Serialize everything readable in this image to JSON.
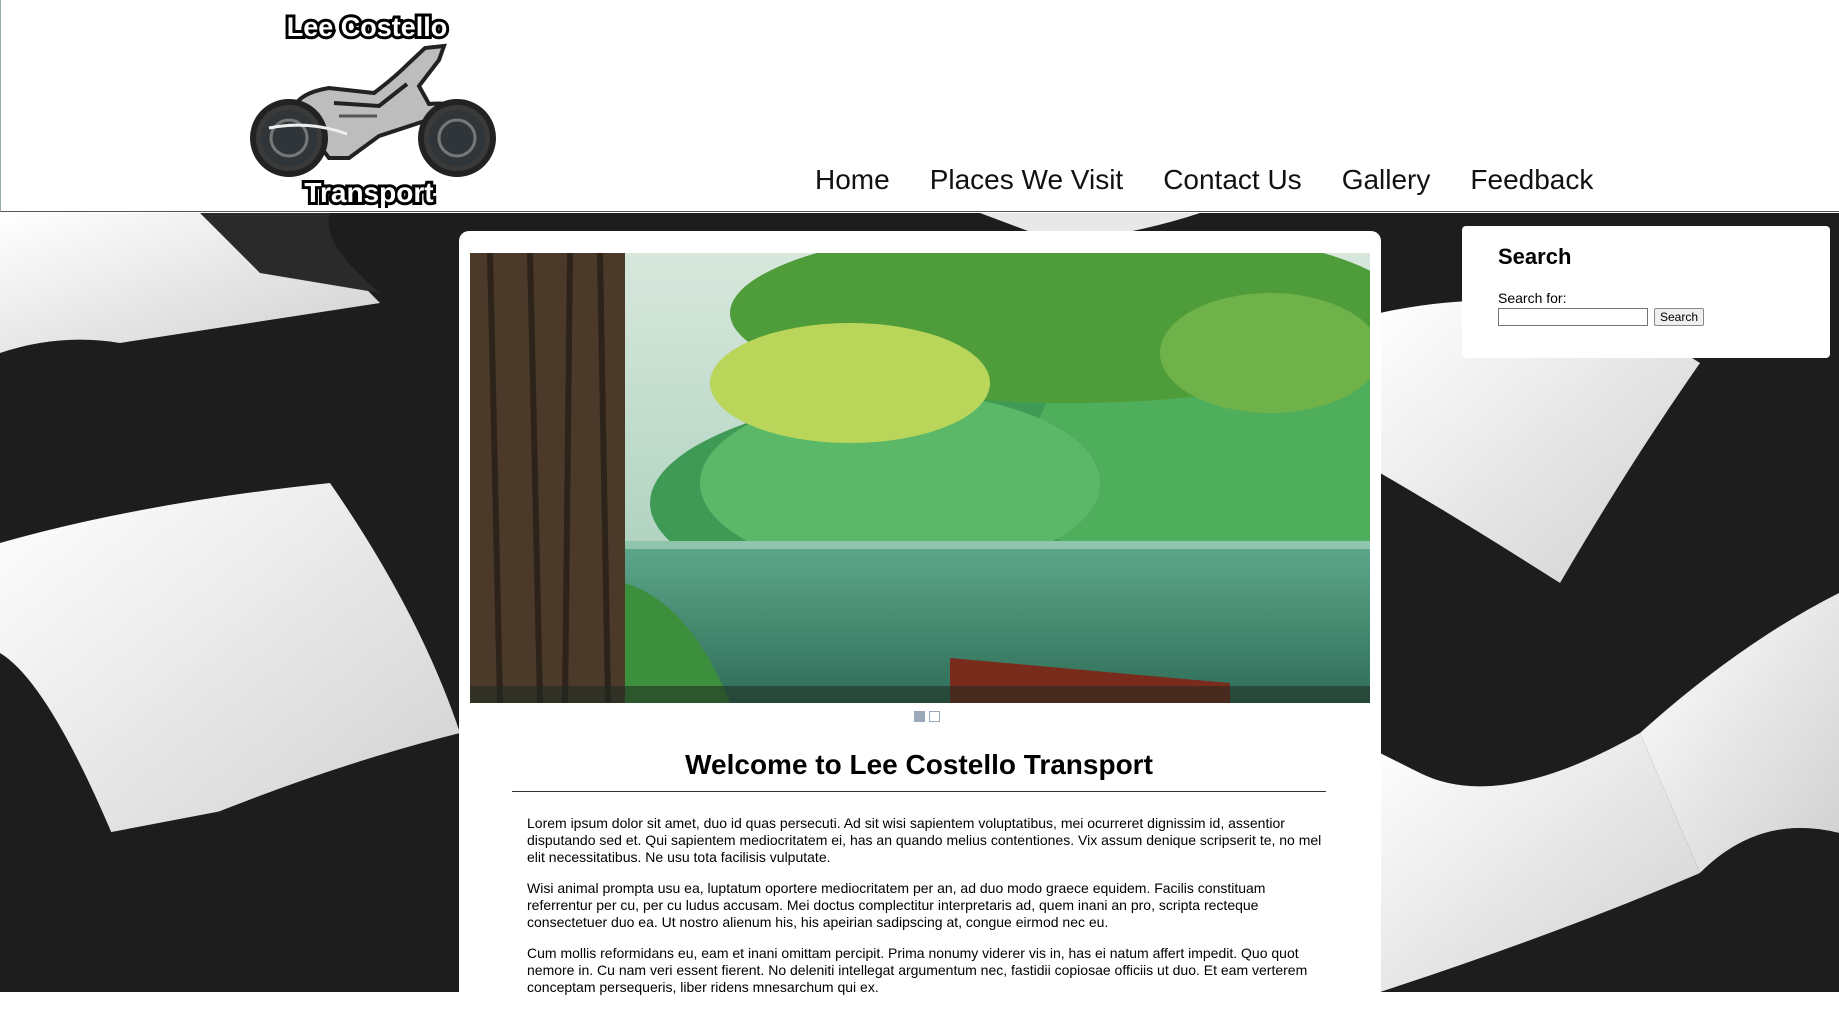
{
  "header": {
    "logo": {
      "top_text": "Lee Costello",
      "bottom_text": "Transport"
    },
    "nav": [
      "Home",
      "Places We Visit",
      "Contact Us",
      "Gallery",
      "Feedback"
    ]
  },
  "slideshow": {
    "pages": 2,
    "active_page": 1
  },
  "main": {
    "title": "Welcome to Lee Costello Transport",
    "paragraphs": [
      "Lorem ipsum dolor sit amet, duo id quas persecuti. Ad sit wisi sapientem voluptatibus, mei ocurreret dignissim id, assentior disputando sed et. Qui sapientem mediocritatem ei, has an quando melius contentiones. Vix assum denique scripserit te, no mel elit necessitatibus. Ne usu tota facilisis vulputate.",
      "Wisi animal prompta usu ea, luptatum oportere mediocritatem per an, ad duo modo graece equidem. Facilis constituam referrentur per cu, per cu ludus accusam. Mei doctus complectitur interpretaris ad, quem inani an pro, scripta recteque consectetuer duo ea. Ut nostro alienum his, his apeirian sadipscing at, congue eirmod nec eu.",
      "Cum mollis reformidans eu, eam et inani omittam percipit. Prima nonumy viderer vis in, has ei natum affert impedit. Quo quot nemore in. Cu nam veri essent fierent. No deleniti intellegat argumentum nec, fastidii copiosae officiis ut duo. Et eam verterem conceptam persequeris, liber ridens mnesarchum qui ex."
    ]
  },
  "sidebar": {
    "title": "Search",
    "label": "Search for:",
    "input_value": "",
    "button_label": "Search"
  },
  "colors": {
    "flag_dark": "#1d1d1d",
    "flag_light": "#eeeeee",
    "pager": "#9aaabb"
  }
}
